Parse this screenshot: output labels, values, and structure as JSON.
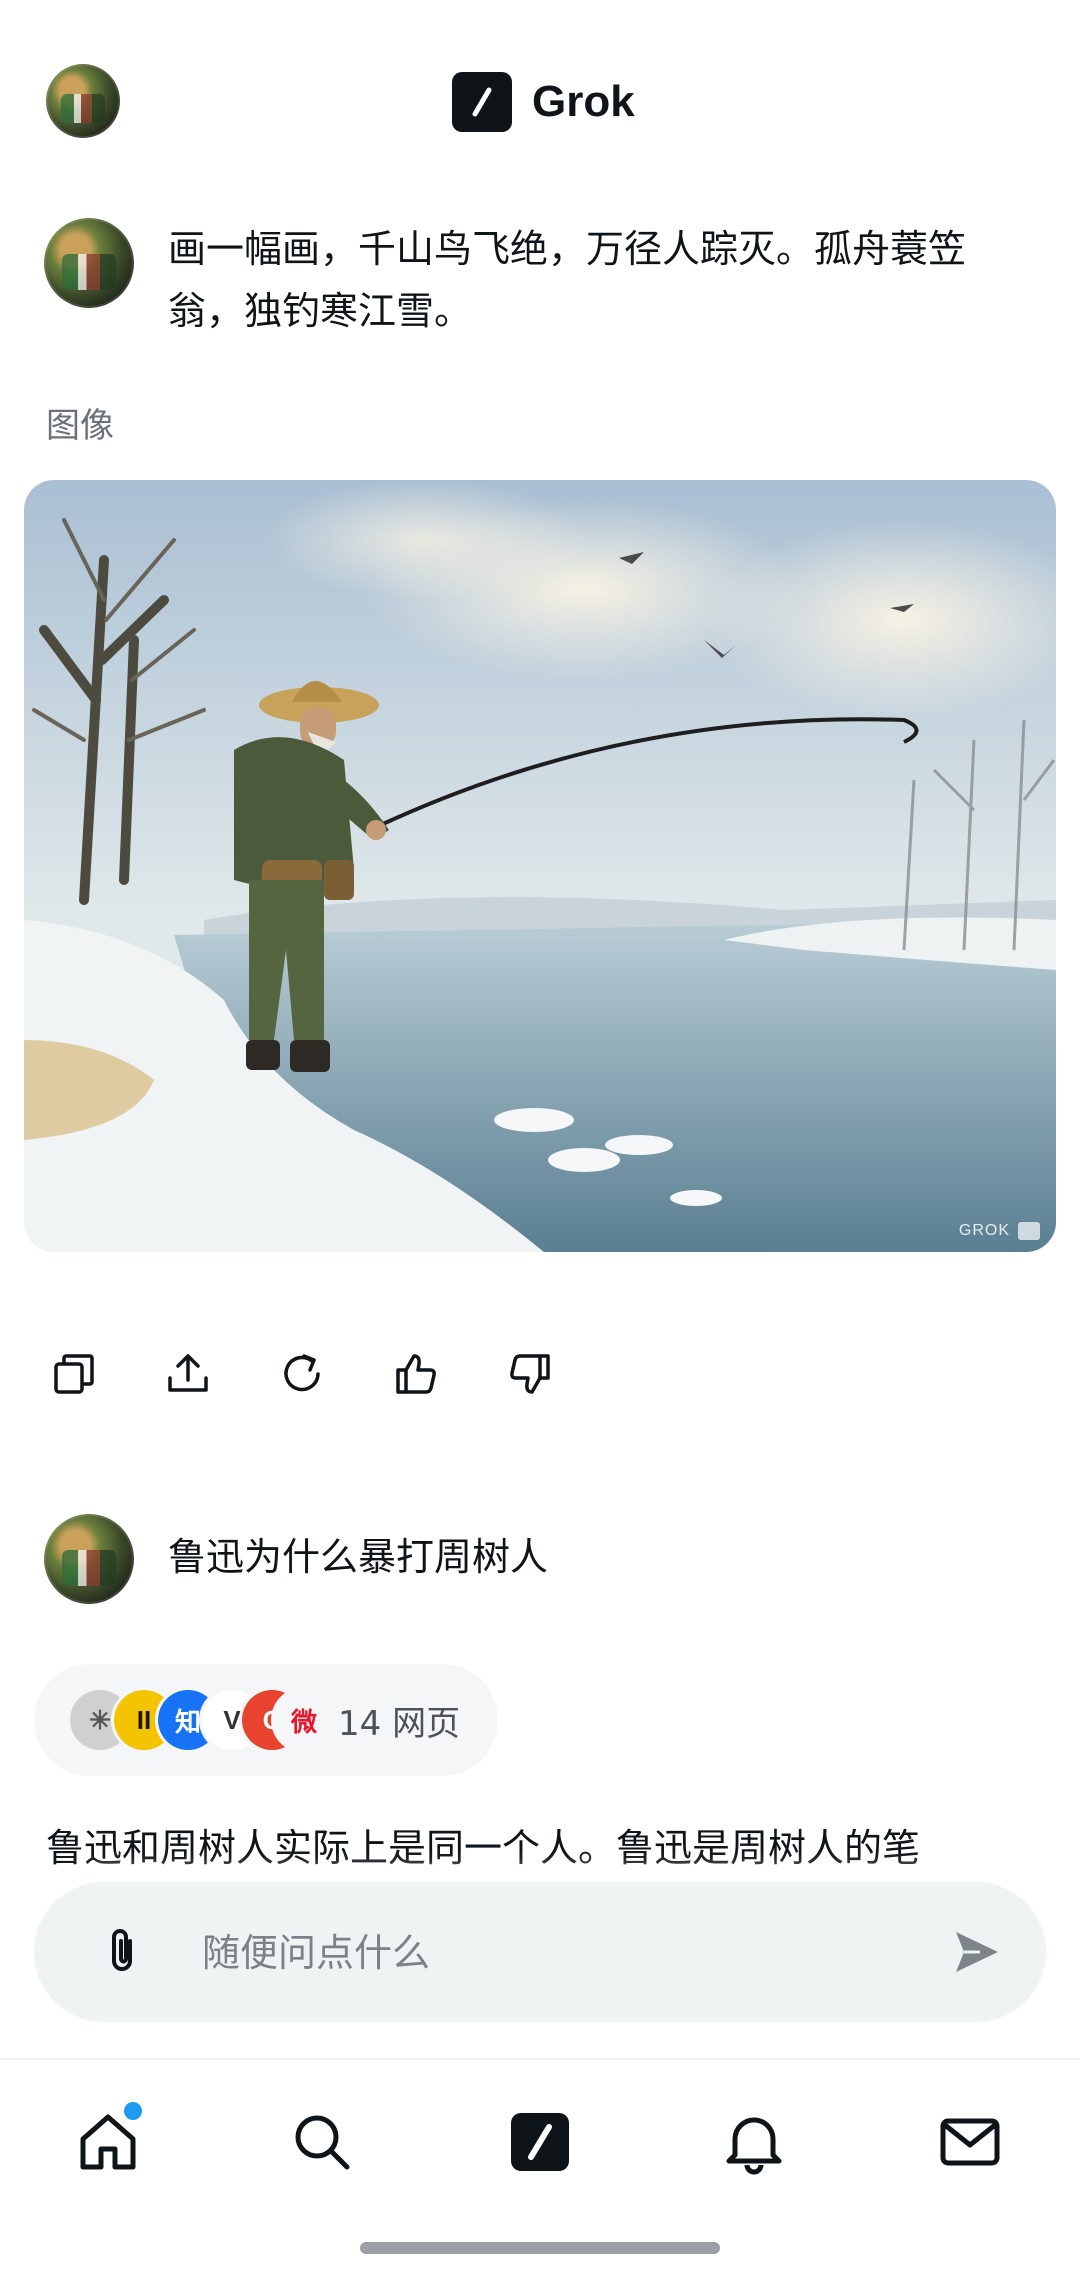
{
  "app": {
    "name": "Grok"
  },
  "conversation": {
    "prompt_1": "画一幅画，千山鸟飞绝，万径人踪灭。孤舟蓑笠翁，独钓寒江雪。",
    "section_label": "图像",
    "image": {
      "icon": "generated-painting-fisherman",
      "watermark": "GROK"
    },
    "actions": [
      {
        "name": "copy-button",
        "icon": "copy-icon"
      },
      {
        "name": "share-button",
        "icon": "share-icon"
      },
      {
        "name": "regenerate-button",
        "icon": "refresh-icon"
      },
      {
        "name": "like-button",
        "icon": "thumbs-up-icon"
      },
      {
        "name": "dislike-button",
        "icon": "thumbs-down-icon"
      }
    ],
    "prompt_2": "鲁迅为什么暴打周树人",
    "sources": {
      "label": "14 网页",
      "icons": [
        {
          "glyph": "✳",
          "color": "#d0d0d0",
          "fg": "#555555"
        },
        {
          "glyph": "II",
          "color": "#f5c400",
          "fg": "#1a1a1a"
        },
        {
          "glyph": "知",
          "color": "#1772f6",
          "fg": "#ffffff"
        },
        {
          "glyph": "V",
          "color": "#ffffff",
          "fg": "#333333"
        },
        {
          "glyph": "C",
          "color": "#e8432e",
          "fg": "#ffffff"
        },
        {
          "glyph": "微",
          "color": "#f5f6f7",
          "fg": "#e6162d"
        }
      ]
    },
    "answer_text": "鲁迅和周树人实际上是同一个人。鲁迅是周树人的笔"
  },
  "composer": {
    "placeholder": "随便问点什么",
    "attach_icon": "paperclip-icon",
    "send_icon": "send-icon"
  },
  "bottom_nav": [
    {
      "name": "nav-home",
      "icon": "home-icon",
      "badge": true
    },
    {
      "name": "nav-search",
      "icon": "search-icon",
      "badge": false
    },
    {
      "name": "nav-grok",
      "icon": "grok-icon",
      "badge": false
    },
    {
      "name": "nav-notifications",
      "icon": "bell-icon",
      "badge": false
    },
    {
      "name": "nav-messages",
      "icon": "mail-icon",
      "badge": false
    }
  ],
  "colors": {
    "text": "#0f1419",
    "muted": "#6b7178",
    "composer_bg": "#eff3f4",
    "accent": "#1d9bf0"
  }
}
